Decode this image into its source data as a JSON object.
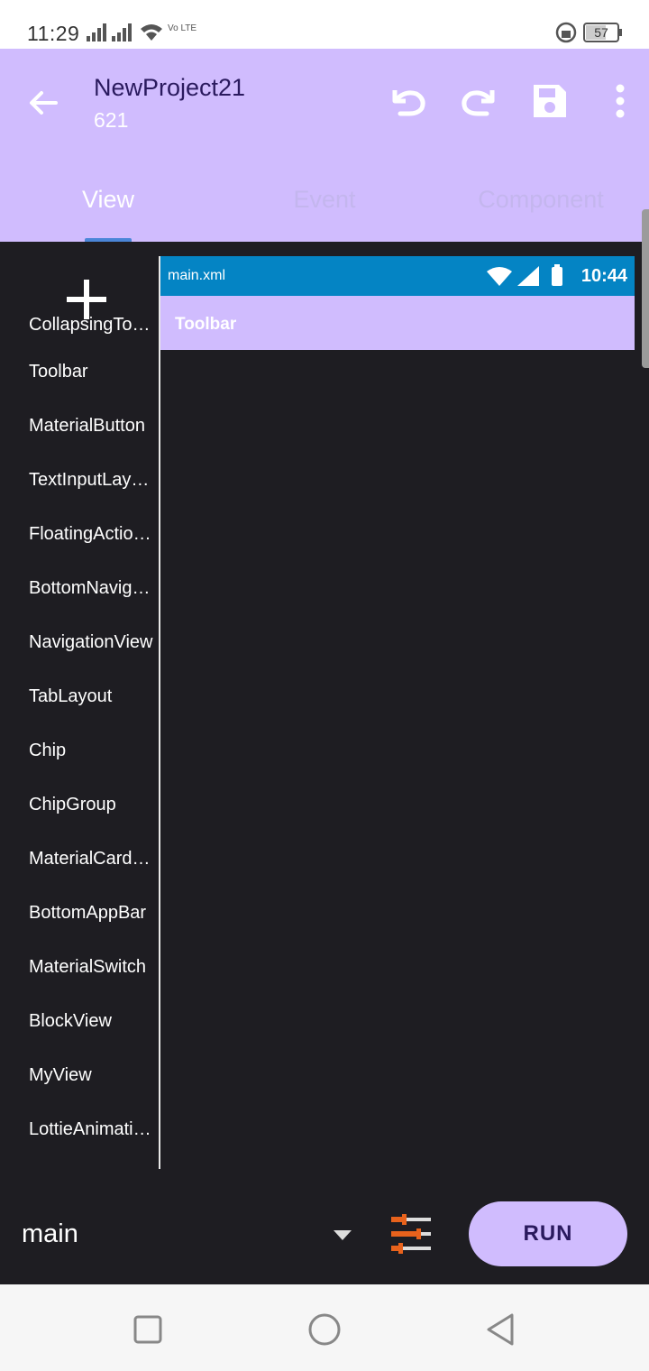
{
  "status_bar": {
    "time": "11:29",
    "network_label": "Vo LTE",
    "battery": "57"
  },
  "app_bar": {
    "title": "NewProject21",
    "subtitle": "621",
    "tabs": [
      {
        "label": "View",
        "active": true
      },
      {
        "label": "Event",
        "active": false
      },
      {
        "label": "Component",
        "active": false
      }
    ]
  },
  "palette": {
    "items": [
      "CollapsingToolbarLayout",
      "Toolbar",
      "MaterialButton",
      "TextInputLayout",
      "FloatingActionButton",
      "BottomNavigationView",
      "NavigationView",
      "TabLayout",
      "Chip",
      "ChipGroup",
      "MaterialCardView",
      "BottomAppBar",
      "MaterialSwitch",
      "BlockView",
      "MyView",
      "LottieAnimationView"
    ]
  },
  "preview": {
    "file_name": "main.xml",
    "time": "10:44",
    "toolbar_title": "Toolbar"
  },
  "bottom": {
    "file_select": "main",
    "run_label": "RUN"
  },
  "colors": {
    "accent": "#d0bcfe",
    "preview_status": "#0484c4",
    "background": "#1e1d22"
  }
}
